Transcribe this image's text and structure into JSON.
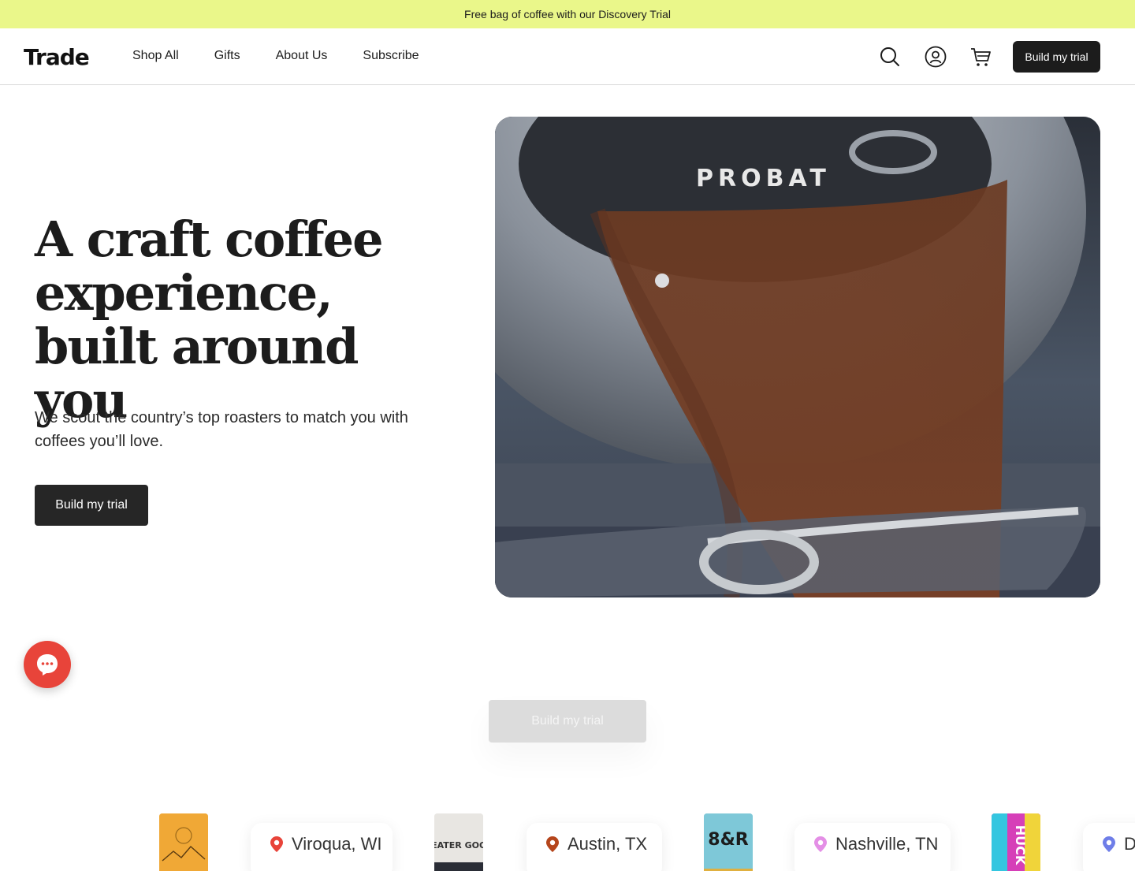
{
  "announcement": {
    "text": "Free bag of coffee with our Discovery Trial"
  },
  "header": {
    "logo": "Trade",
    "nav": [
      "Shop All",
      "Gifts",
      "About Us",
      "Subscribe"
    ],
    "cta": "Build my trial",
    "icons": [
      "search-icon",
      "account-icon",
      "cart-icon"
    ]
  },
  "hero": {
    "title": "A craft coffee experience, built around you",
    "subtitle": "We scout the country’s top roasters to match you with coffees you’ll love.",
    "cta": "Build my trial",
    "media_label": "PROBAT"
  },
  "sticky_cta": "Build my trial",
  "chat": {
    "icon": "chat-icon"
  },
  "roasters": [
    {
      "bag_text": "",
      "bag_color": "#f0a836",
      "location": "Viroqua, WI",
      "pin_color": "#e8443a"
    },
    {
      "bag_text": "GREATER GOODS",
      "bag_color": "#e8e6e2",
      "location": "Austin, TX",
      "pin_color": "#b5451b"
    },
    {
      "bag_text": "8&R",
      "bag_color": "#7ec8d8",
      "location": "Nashville, TN",
      "pin_color": "#e48fe6"
    },
    {
      "bag_text": "HUCK",
      "bag_color": "#d63fb8",
      "location": "D",
      "pin_color": "#6f7ee8"
    }
  ]
}
